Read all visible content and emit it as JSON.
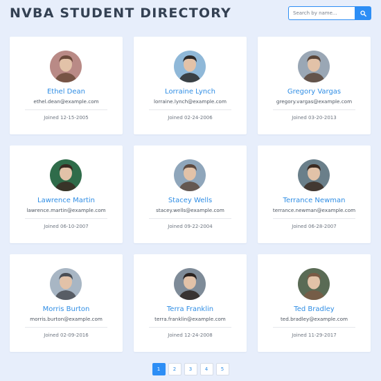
{
  "header": {
    "title": "NVBA STUDENT DIRECTORY",
    "search_placeholder": "Search by name...",
    "search_icon": "search-icon"
  },
  "students": [
    {
      "name": "Ethel Dean",
      "email": "ethel.dean@example.com",
      "joined": "Joined 12-15-2005",
      "avatar_bg": "#b98a86",
      "avatar_fg": "#6b4a3a"
    },
    {
      "name": "Lorraine Lynch",
      "email": "lorraine.lynch@example.com",
      "joined": "Joined 02-24-2006",
      "avatar_bg": "#8fb8d8",
      "avatar_fg": "#2c2a2a"
    },
    {
      "name": "Gregory Vargas",
      "email": "gregory.vargas@example.com",
      "joined": "Joined 03-20-2013",
      "avatar_bg": "#9aa7b5",
      "avatar_fg": "#5a4538"
    },
    {
      "name": "Lawrence Martin",
      "email": "lawrence.martin@example.com",
      "joined": "Joined 06-10-2007",
      "avatar_bg": "#2f6c4a",
      "avatar_fg": "#3a2a22"
    },
    {
      "name": "Stacey Wells",
      "email": "stacey.wells@example.com",
      "joined": "Joined 09-22-2004",
      "avatar_bg": "#8fa6bb",
      "avatar_fg": "#5d4a40"
    },
    {
      "name": "Terrance Newman",
      "email": "terrance.newman@example.com",
      "joined": "Joined 06-28-2007",
      "avatar_bg": "#6a7f8a",
      "avatar_fg": "#3b2b22"
    },
    {
      "name": "Morris Burton",
      "email": "morris.burton@example.com",
      "joined": "Joined 02-09-2016",
      "avatar_bg": "#a8b6c4",
      "avatar_fg": "#4a4e55"
    },
    {
      "name": "Terra Franklin",
      "email": "terra.franklin@example.com",
      "joined": "Joined 12-24-2008",
      "avatar_bg": "#7e8b98",
      "avatar_fg": "#2b2320"
    },
    {
      "name": "Ted Bradley",
      "email": "ted.bradley@example.com",
      "joined": "Joined 11-29-2017",
      "avatar_bg": "#5a6b55",
      "avatar_fg": "#7a5a45"
    }
  ],
  "pagination": {
    "pages": [
      "1",
      "2",
      "3",
      "4",
      "5"
    ],
    "active": "1"
  },
  "colors": {
    "accent": "#2d8ef5",
    "name_link": "#2f8de4",
    "background": "#e7eefb"
  }
}
